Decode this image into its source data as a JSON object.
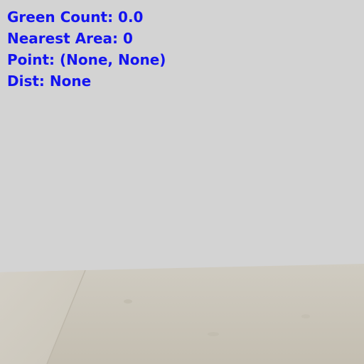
{
  "hud": {
    "green_count": "Green Count: 0.0",
    "nearest_area": "Nearest Area: 0",
    "point": "Point: (None, None)",
    "dist": "Dist: None"
  },
  "colors": {
    "hud_text": "#1414f0",
    "wall": "#d3d3d3",
    "floor": "#c8c2b6"
  }
}
